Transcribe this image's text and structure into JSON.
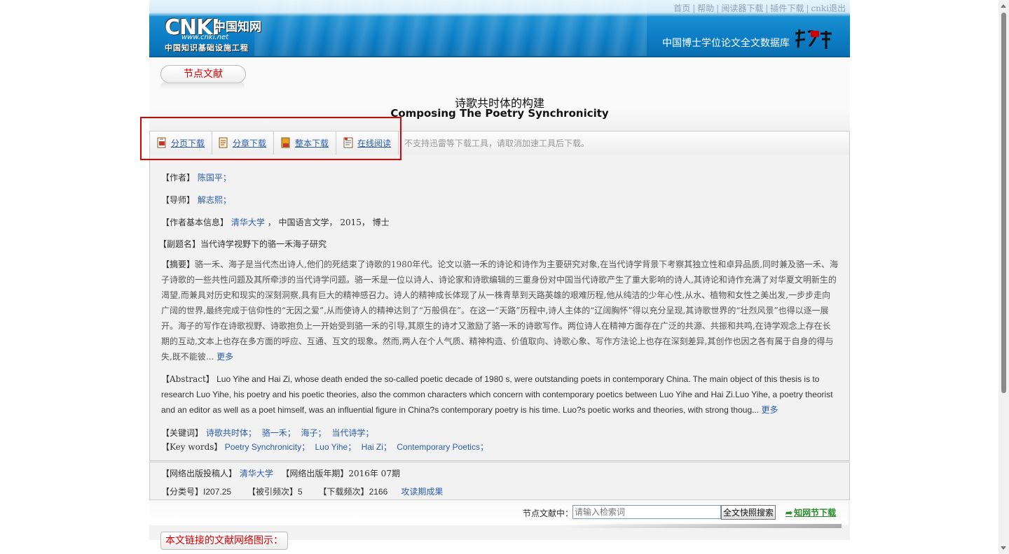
{
  "top_nav": [
    "首页",
    "帮助",
    "阅读器下载",
    "插件下载",
    "cnki退出"
  ],
  "logo": {
    "cnki": "CNKI",
    "cn": "中国知网",
    "url": "www.cnki.net",
    "sub": "中国知识基础设施工程"
  },
  "db_name": "中国博士学位论文全文数据库",
  "badge": "节点文献",
  "title_cn": "诗歌共时体的构建",
  "title_en": "Composing The Poetry Synchronicity",
  "toolbar": {
    "items": [
      "分页下载",
      "分章下载",
      "整本下载",
      "在线阅读"
    ],
    "note": "不支持迅雷等下载工具，请取消加速工具后下载。"
  },
  "author": {
    "label": "【作者】",
    "value": "陈国平；"
  },
  "advisor": {
    "label": "【导师】",
    "value": "解志熙；"
  },
  "author_info": {
    "label": "【作者基本信息】",
    "school": "清华大学",
    "rest": "，  中国语言文学，  2015，  博士"
  },
  "subtitle": {
    "label": "【副题名】",
    "value": "当代诗学视野下的骆一禾海子研究"
  },
  "abstract_cn": {
    "label": "【摘要】",
    "text": "骆一禾、海子是当代杰出诗人,他们的死结束了诗歌的1980年代。论文以骆一禾的诗论和诗作为主要研究对象,在当代诗学背景下考察其独立性和卓异品质,同时兼及骆一禾、海子诗歌的一些共性问题及其所牵涉的当代诗学问题。骆一禾是一位以诗人、诗论家和诗歌编辑的三重身份对中国当代诗歌产生了重大影响的诗人,其诗论和诗作充满了对华夏文明新生的渴望,而兼具对历史和现实的深刻洞察,具有巨大的精神感召力。诗人的精神成长体现了从一株青草到天路英雄的艰难历程,他从纯洁的少年心性,从水、植物和女性之美出发,一步步走向广阔的世界,最终完成于信仰性的“无因之爱”,从而使诗人的精神达到了“万般俱在”。在这一“天路”历程中,诗人主体的“辽阔胸怀”得以充分呈现,其诗歌世界的“壮烈风景”也得以逐一展开。海子的写作在诗歌视野、诗歌抱负上一开始受到骆一禾的引导,其原生的诗才又激励了骆一禾的诗歌写作。两位诗人在精神方面存在广泛的共源、共振和共鸣,在诗学观念上存在长期的互动,文本上也存在多方面的呼应、互通、互文的现象。然而,两人在个人气质、精神构造、价值取向、诗歌心象、写作方法论上也存在深刻差异,其创作也因之各有属于自身的得与失,既不能彼...",
    "more": "更多"
  },
  "abstract_en": {
    "label": "【Abstract】",
    "text": "Luo Yihe and Hai Zi, whose death ended the so-called poetic decade of 1980 s, were outstanding poets in contemporary China. The main object of this thesis is to research Luo Yihe, his poetry and his poetic theories, also the common characters which concern with contemporary poetics between Luo Yihe and Hai Zi.Luo Yihe, a poetry theorist and an editor as well as a poet himself, was an influential figure in China?s contemporary poetry is his time. Luo?s poetic works and theories, with strong thoug...",
    "more": "更多"
  },
  "keywords_cn": {
    "label": "【关键词】",
    "items": [
      "诗歌共时体；",
      "骆一禾；",
      "海子；",
      "当代诗学；"
    ]
  },
  "keywords_en": {
    "label": "【Key words】",
    "items": [
      "Poetry Synchronicity；",
      "Luo Yihe；",
      "Hai Zi；",
      "Contemporary Poetics；"
    ]
  },
  "pub": {
    "submitter_label": "【网络出版投稿人】",
    "submitter": "清华大学",
    "year_label": "【网络出版年期】",
    "year": "2016年 07期",
    "class_label": "【分类号】",
    "class": "I207.25",
    "cited_label": "【被引频次】",
    "cited": "5",
    "dl_label": "【下载频次】",
    "dl": "2166",
    "extra_link": "攻读期成果"
  },
  "search": {
    "label": "节点文献中：",
    "placeholder": "请输入检索词",
    "button": "全文快照搜索",
    "download": "知网节下载"
  },
  "network_button": "本文链接的文献网络图示："
}
